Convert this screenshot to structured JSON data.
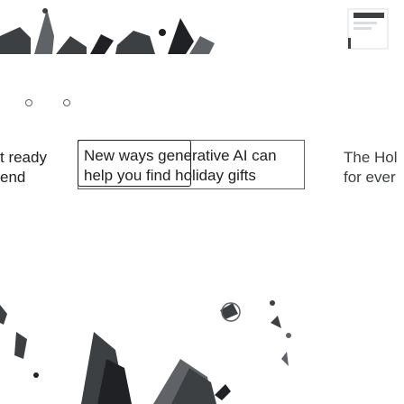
{
  "carousel": {
    "cards": [
      {
        "title": "t ready\nend"
      },
      {
        "title": "New ways generative AI can help you find holiday gifts"
      },
      {
        "title": "The Hol\nfor ever"
      }
    ],
    "dots": [
      "dot-1",
      "dot-2"
    ]
  },
  "icons": {
    "top_strip": "holiday-illustration-icon",
    "bottom_art": "gift-shapes-illustration-icon"
  },
  "colors": {
    "text": "#202124",
    "border": "#5f6368",
    "illustration_dark": "#3c4043",
    "illustration_light": "#dadce0"
  }
}
